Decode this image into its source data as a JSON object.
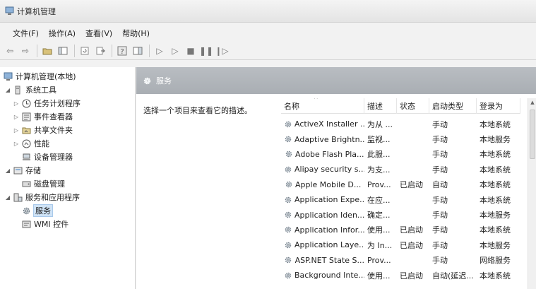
{
  "window": {
    "title": "计算机管理"
  },
  "menu": [
    "文件(F)",
    "操作(A)",
    "查看(V)",
    "帮助(H)"
  ],
  "tree": [
    {
      "label": "计算机管理(本地)",
      "icon": "computer-icon",
      "expander": ""
    },
    {
      "label": "系统工具",
      "icon": "tools-icon",
      "expander": "◢"
    },
    {
      "label": "任务计划程序",
      "icon": "clock-icon",
      "expander": "▷"
    },
    {
      "label": "事件查看器",
      "icon": "event-viewer-icon",
      "expander": "▷"
    },
    {
      "label": "共享文件夹",
      "icon": "shared-folder-icon",
      "expander": "▷"
    },
    {
      "label": "性能",
      "icon": "performance-icon",
      "expander": "▷"
    },
    {
      "label": "设备管理器",
      "icon": "device-manager-icon",
      "expander": ""
    },
    {
      "label": "存储",
      "icon": "storage-icon",
      "expander": "◢"
    },
    {
      "label": "磁盘管理",
      "icon": "disk-icon",
      "expander": ""
    },
    {
      "label": "服务和应用程序",
      "icon": "services-apps-icon",
      "expander": "◢"
    },
    {
      "label": "服务",
      "icon": "gear-icon",
      "expander": ""
    },
    {
      "label": "WMI 控件",
      "icon": "wmi-icon",
      "expander": ""
    }
  ],
  "main": {
    "header_title": "服务",
    "description": "选择一个项目来查看它的描述。"
  },
  "columns": [
    "名称",
    "描述",
    "状态",
    "启动类型",
    "登录为"
  ],
  "services": [
    {
      "name": "ActiveX Installer ...",
      "desc": "为从 ...",
      "status": "",
      "startup": "手动",
      "logon": "本地系统"
    },
    {
      "name": "Adaptive Brightn...",
      "desc": "监视...",
      "status": "",
      "startup": "手动",
      "logon": "本地服务"
    },
    {
      "name": "Adobe Flash Pla...",
      "desc": "此服...",
      "status": "",
      "startup": "手动",
      "logon": "本地系统"
    },
    {
      "name": "Alipay security s...",
      "desc": "为支...",
      "status": "",
      "startup": "手动",
      "logon": "本地系统"
    },
    {
      "name": "Apple Mobile D...",
      "desc": "Prov...",
      "status": "已启动",
      "startup": "自动",
      "logon": "本地系统"
    },
    {
      "name": "Application Expe...",
      "desc": "在应...",
      "status": "",
      "startup": "手动",
      "logon": "本地系统"
    },
    {
      "name": "Application Iden...",
      "desc": "确定...",
      "status": "",
      "startup": "手动",
      "logon": "本地服务"
    },
    {
      "name": "Application Infor...",
      "desc": "使用...",
      "status": "已启动",
      "startup": "手动",
      "logon": "本地系统"
    },
    {
      "name": "Application Laye...",
      "desc": "为 In...",
      "status": "已启动",
      "startup": "手动",
      "logon": "本地服务"
    },
    {
      "name": "ASP.NET State S...",
      "desc": "Prov...",
      "status": "",
      "startup": "手动",
      "logon": "网络服务"
    },
    {
      "name": "Background Inte...",
      "desc": "使用...",
      "status": "已启动",
      "startup": "自动(延迟...",
      "logon": "本地系统"
    }
  ],
  "toolbar_icons": [
    "back-arrow-icon",
    "forward-arrow-icon",
    "up-folder-icon",
    "show-hide-tree-icon",
    "refresh-icon",
    "export-list-icon",
    "help-icon",
    "action-pane-icon",
    "play-icon",
    "play-alt-icon",
    "stop-icon",
    "pause-icon",
    "restart-icon"
  ],
  "colors": {
    "selection": "#cfe3f6",
    "header_bar": "#b0b5ba"
  }
}
